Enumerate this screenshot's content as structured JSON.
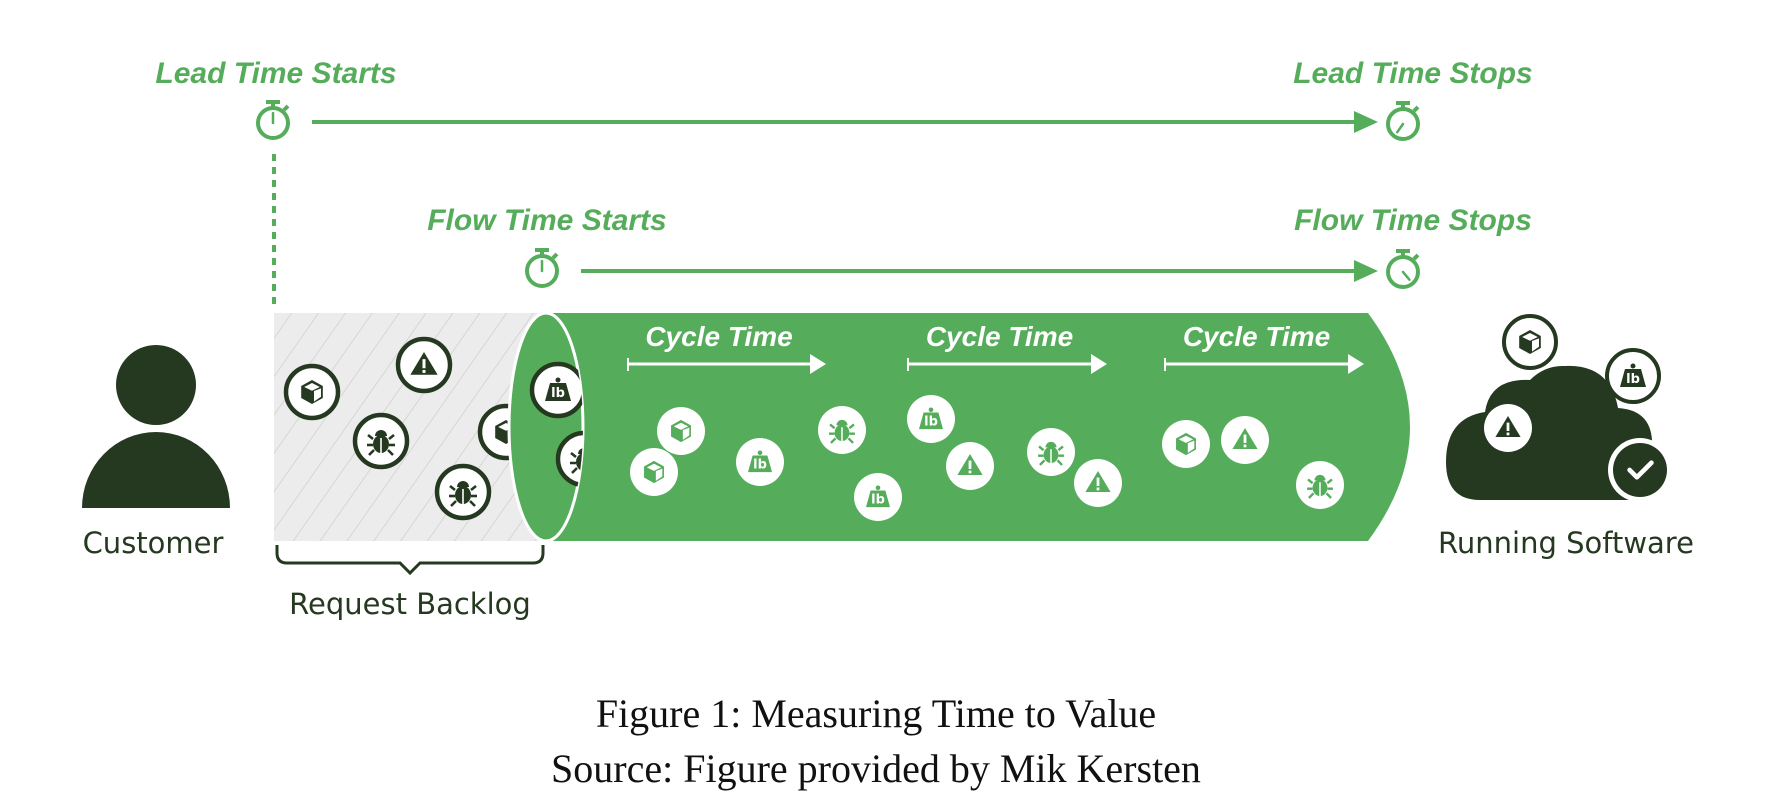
{
  "colors": {
    "green": "#55ad5b",
    "dark": "#253820",
    "backlog_fill": "#ececec",
    "backlog_stripe": "#d2d2d2",
    "white": "#ffffff"
  },
  "lead_time": {
    "start_label": "Lead Time Starts",
    "stop_label": "Lead Time Stops"
  },
  "flow_time": {
    "start_label": "Flow Time Starts",
    "stop_label": "Flow Time Stops"
  },
  "cycle_times": [
    {
      "label": "Cycle Time"
    },
    {
      "label": "Cycle Time"
    },
    {
      "label": "Cycle Time"
    }
  ],
  "customer": {
    "label": "Customer",
    "icon": "person-icon"
  },
  "backlog": {
    "label": "Request Backlog",
    "items": [
      "box",
      "warning",
      "bug",
      "box",
      "bug",
      "weight",
      "bug"
    ]
  },
  "pipeline": {
    "items": [
      "box",
      "box",
      "weight",
      "bug",
      "weight",
      "weight",
      "warning",
      "bug",
      "warning",
      "box",
      "warning",
      "bug"
    ]
  },
  "running_software": {
    "label": "Running Software",
    "icon": "cloud-icon",
    "items": [
      "box",
      "weight",
      "warning",
      "check"
    ]
  },
  "weight_text": "lb",
  "caption": {
    "title": "Figure 1: Measuring Time to Value",
    "source": "Source: Figure provided by Mik Kersten"
  }
}
